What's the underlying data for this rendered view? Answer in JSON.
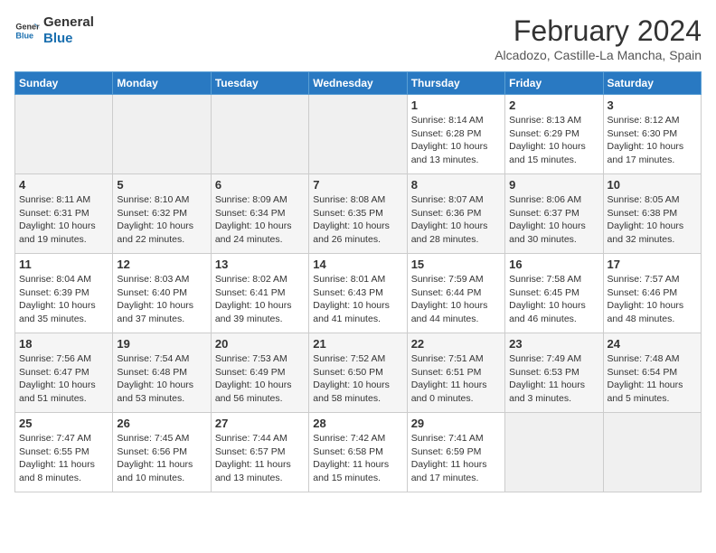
{
  "logo": {
    "line1": "General",
    "line2": "Blue"
  },
  "title": "February 2024",
  "subtitle": "Alcadozo, Castille-La Mancha, Spain",
  "headers": [
    "Sunday",
    "Monday",
    "Tuesday",
    "Wednesday",
    "Thursday",
    "Friday",
    "Saturday"
  ],
  "weeks": [
    [
      {
        "day": "",
        "info": ""
      },
      {
        "day": "",
        "info": ""
      },
      {
        "day": "",
        "info": ""
      },
      {
        "day": "",
        "info": ""
      },
      {
        "day": "1",
        "info": "Sunrise: 8:14 AM\nSunset: 6:28 PM\nDaylight: 10 hours\nand 13 minutes."
      },
      {
        "day": "2",
        "info": "Sunrise: 8:13 AM\nSunset: 6:29 PM\nDaylight: 10 hours\nand 15 minutes."
      },
      {
        "day": "3",
        "info": "Sunrise: 8:12 AM\nSunset: 6:30 PM\nDaylight: 10 hours\nand 17 minutes."
      }
    ],
    [
      {
        "day": "4",
        "info": "Sunrise: 8:11 AM\nSunset: 6:31 PM\nDaylight: 10 hours\nand 19 minutes."
      },
      {
        "day": "5",
        "info": "Sunrise: 8:10 AM\nSunset: 6:32 PM\nDaylight: 10 hours\nand 22 minutes."
      },
      {
        "day": "6",
        "info": "Sunrise: 8:09 AM\nSunset: 6:34 PM\nDaylight: 10 hours\nand 24 minutes."
      },
      {
        "day": "7",
        "info": "Sunrise: 8:08 AM\nSunset: 6:35 PM\nDaylight: 10 hours\nand 26 minutes."
      },
      {
        "day": "8",
        "info": "Sunrise: 8:07 AM\nSunset: 6:36 PM\nDaylight: 10 hours\nand 28 minutes."
      },
      {
        "day": "9",
        "info": "Sunrise: 8:06 AM\nSunset: 6:37 PM\nDaylight: 10 hours\nand 30 minutes."
      },
      {
        "day": "10",
        "info": "Sunrise: 8:05 AM\nSunset: 6:38 PM\nDaylight: 10 hours\nand 32 minutes."
      }
    ],
    [
      {
        "day": "11",
        "info": "Sunrise: 8:04 AM\nSunset: 6:39 PM\nDaylight: 10 hours\nand 35 minutes."
      },
      {
        "day": "12",
        "info": "Sunrise: 8:03 AM\nSunset: 6:40 PM\nDaylight: 10 hours\nand 37 minutes."
      },
      {
        "day": "13",
        "info": "Sunrise: 8:02 AM\nSunset: 6:41 PM\nDaylight: 10 hours\nand 39 minutes."
      },
      {
        "day": "14",
        "info": "Sunrise: 8:01 AM\nSunset: 6:43 PM\nDaylight: 10 hours\nand 41 minutes."
      },
      {
        "day": "15",
        "info": "Sunrise: 7:59 AM\nSunset: 6:44 PM\nDaylight: 10 hours\nand 44 minutes."
      },
      {
        "day": "16",
        "info": "Sunrise: 7:58 AM\nSunset: 6:45 PM\nDaylight: 10 hours\nand 46 minutes."
      },
      {
        "day": "17",
        "info": "Sunrise: 7:57 AM\nSunset: 6:46 PM\nDaylight: 10 hours\nand 48 minutes."
      }
    ],
    [
      {
        "day": "18",
        "info": "Sunrise: 7:56 AM\nSunset: 6:47 PM\nDaylight: 10 hours\nand 51 minutes."
      },
      {
        "day": "19",
        "info": "Sunrise: 7:54 AM\nSunset: 6:48 PM\nDaylight: 10 hours\nand 53 minutes."
      },
      {
        "day": "20",
        "info": "Sunrise: 7:53 AM\nSunset: 6:49 PM\nDaylight: 10 hours\nand 56 minutes."
      },
      {
        "day": "21",
        "info": "Sunrise: 7:52 AM\nSunset: 6:50 PM\nDaylight: 10 hours\nand 58 minutes."
      },
      {
        "day": "22",
        "info": "Sunrise: 7:51 AM\nSunset: 6:51 PM\nDaylight: 11 hours\nand 0 minutes."
      },
      {
        "day": "23",
        "info": "Sunrise: 7:49 AM\nSunset: 6:53 PM\nDaylight: 11 hours\nand 3 minutes."
      },
      {
        "day": "24",
        "info": "Sunrise: 7:48 AM\nSunset: 6:54 PM\nDaylight: 11 hours\nand 5 minutes."
      }
    ],
    [
      {
        "day": "25",
        "info": "Sunrise: 7:47 AM\nSunset: 6:55 PM\nDaylight: 11 hours\nand 8 minutes."
      },
      {
        "day": "26",
        "info": "Sunrise: 7:45 AM\nSunset: 6:56 PM\nDaylight: 11 hours\nand 10 minutes."
      },
      {
        "day": "27",
        "info": "Sunrise: 7:44 AM\nSunset: 6:57 PM\nDaylight: 11 hours\nand 13 minutes."
      },
      {
        "day": "28",
        "info": "Sunrise: 7:42 AM\nSunset: 6:58 PM\nDaylight: 11 hours\nand 15 minutes."
      },
      {
        "day": "29",
        "info": "Sunrise: 7:41 AM\nSunset: 6:59 PM\nDaylight: 11 hours\nand 17 minutes."
      },
      {
        "day": "",
        "info": ""
      },
      {
        "day": "",
        "info": ""
      }
    ]
  ]
}
